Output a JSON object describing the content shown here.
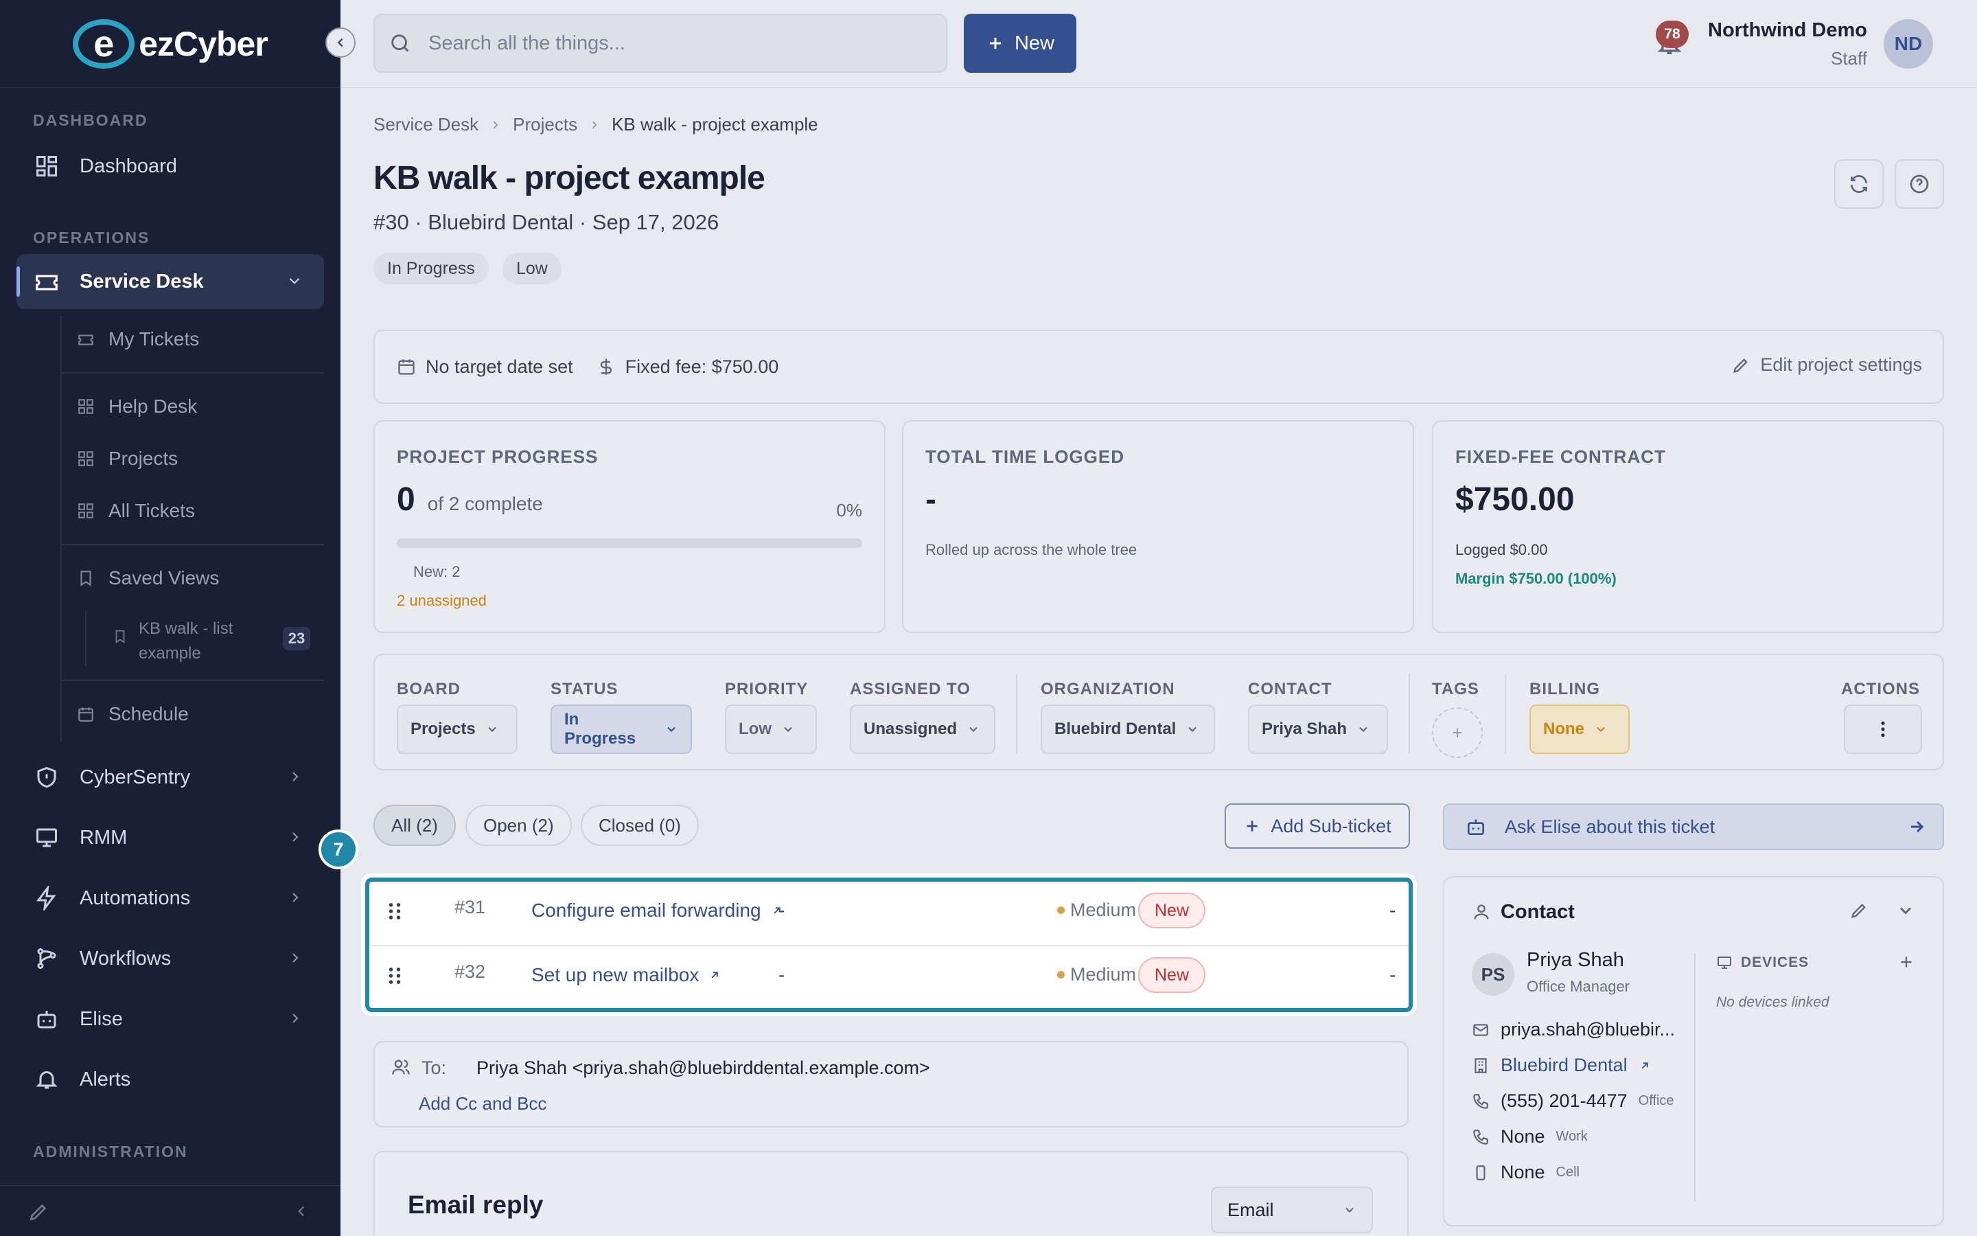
{
  "brand": {
    "logo_letter": "e",
    "logo_text": "ezCyber"
  },
  "sidebar": {
    "dashboard_heading": "DASHBOARD",
    "dashboard_item": "Dashboard",
    "operations_heading": "OPERATIONS",
    "service_desk": "Service Desk",
    "sub_items": [
      "My Tickets",
      "Help Desk",
      "Projects",
      "All Tickets",
      "Saved Views"
    ],
    "saved_view_line1": "KB walk - list",
    "saved_view_line2": "example",
    "saved_view_count": "23",
    "schedule": "Schedule",
    "items": [
      "CyberSentry",
      "RMM",
      "Automations",
      "Workflows",
      "Elise",
      "Alerts"
    ],
    "admin_heading": "ADMINISTRATION"
  },
  "topbar": {
    "search_placeholder": "Search all the things...",
    "new_label": "New",
    "notif_count": "78",
    "user_name": "Northwind Demo",
    "user_role": "Staff",
    "avatar_initials": "ND"
  },
  "page": {
    "breadcrumb": [
      "Service Desk",
      "Projects",
      "KB walk - project example"
    ],
    "title": "KB walk - project example",
    "subtitle": "#30 · Bluebird Dental · Sep 17, 2026",
    "status_pill": "In Progress",
    "priority_pill": "Low"
  },
  "infobar": {
    "target": "No target date set",
    "fee": "Fixed fee: $750.00",
    "edit": "Edit project settings"
  },
  "progress": {
    "heading": "PROJECT PROGRESS",
    "done": "0",
    "of": "of 2 complete",
    "percent_label": "0%",
    "fraction": 0,
    "breakdown": "New: 2",
    "unassigned": "2 unassigned"
  },
  "time": {
    "heading": "TOTAL TIME LOGGED",
    "value": "-",
    "note": "Rolled up across the whole tree"
  },
  "contract": {
    "heading": "FIXED-FEE CONTRACT",
    "value": "$750.00",
    "logged": "Logged $0.00",
    "margin": "Margin $750.00 (100%)"
  },
  "filters": {
    "board_label": "BOARD",
    "board": "Projects",
    "status_label": "STATUS",
    "status": "In Progress",
    "priority_label": "PRIORITY",
    "priority": "Low",
    "assigned_label": "ASSIGNED TO",
    "assigned": "Unassigned",
    "org_label": "ORGANIZATION",
    "org": "Bluebird Dental",
    "contact_label": "CONTACT",
    "contact": "Priya Shah",
    "tags_label": "TAGS",
    "billing_label": "BILLING",
    "billing": "None",
    "actions_label": "ACTIONS"
  },
  "tabs": {
    "all": "All (2)",
    "open": "Open (2)",
    "closed": "Closed (0)"
  },
  "add_subticket": "Add Sub-ticket",
  "ask_elise": "Ask Elise about this ticket",
  "subtickets": [
    {
      "num": "#31",
      "title": "Configure email forwarding",
      "assignee": "-",
      "priority": "Medium",
      "status": "New",
      "due": "-"
    },
    {
      "num": "#32",
      "title": "Set up new mailbox",
      "assignee": "-",
      "priority": "Medium",
      "status": "New",
      "due": "-"
    }
  ],
  "tour_step": "7",
  "email": {
    "to_label": "To:",
    "to": "Priya Shah <priya.shah@bluebirddental.example.com>",
    "add_cc": "Add Cc and Bcc",
    "reply_title": "Email reply",
    "channel": "Email"
  },
  "contact_card": {
    "heading": "Contact",
    "initials": "PS",
    "name": "Priya Shah",
    "role": "Office Manager",
    "email": "priya.shah@bluebir...",
    "org": "Bluebird Dental",
    "phone": "(555) 201-4477",
    "phone_type": "Office",
    "work": "None",
    "work_type": "Work",
    "cell": "None",
    "cell_type": "Cell",
    "devices_heading": "DEVICES",
    "devices_empty": "No devices linked"
  },
  "colors": {
    "sidebar": "#192035",
    "accent": "#34508f",
    "highlight": "#1f87a8",
    "status_new": "#c52f2f",
    "margin": "#1a8a7a",
    "unassigned": "#c98410"
  }
}
